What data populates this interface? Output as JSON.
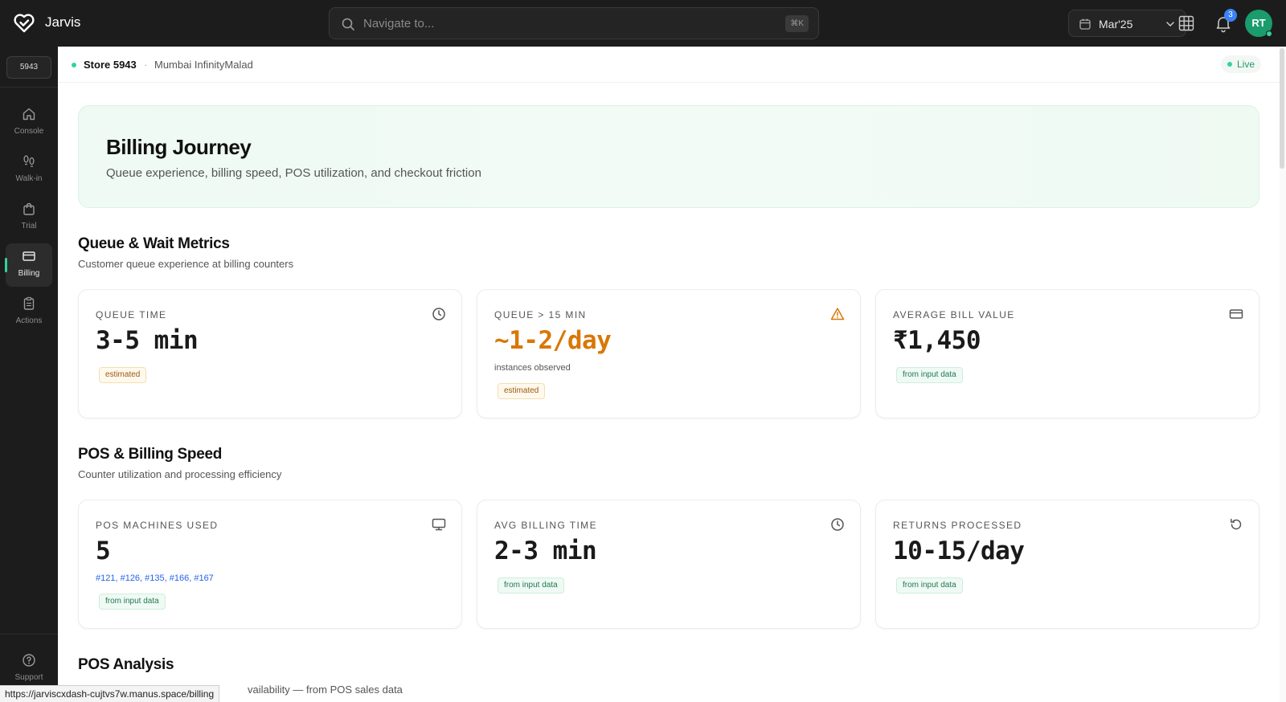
{
  "app": {
    "name": "Jarvis"
  },
  "search": {
    "placeholder": "Navigate to...",
    "shortcut": "⌘K"
  },
  "header": {
    "month": "Mar'25",
    "notifications_count": "3",
    "avatar_initials": "RT"
  },
  "sidebar": {
    "store_chip": "5943",
    "items": [
      {
        "label": "Console",
        "icon": "home-icon"
      },
      {
        "label": "Walk-in",
        "icon": "footprints-icon"
      },
      {
        "label": "Trial",
        "icon": "shopping-bag-icon"
      },
      {
        "label": "Billing",
        "icon": "credit-card-icon",
        "active": true
      },
      {
        "label": "Actions",
        "icon": "clipboard-icon"
      }
    ],
    "support": {
      "label": "Support",
      "icon": "help-circle-icon"
    }
  },
  "store": {
    "name": "Store 5943",
    "separator": "·",
    "location": "Mumbai InfinityMalad",
    "status": "Live"
  },
  "hero": {
    "title": "Billing Journey",
    "subtitle": "Queue experience, billing speed, POS utilization, and checkout friction"
  },
  "sections": [
    {
      "title": "Queue & Wait Metrics",
      "subtitle": "Customer queue experience at billing counters",
      "cards": [
        {
          "label": "QUEUE TIME",
          "value": "3-5 min",
          "icon": "clock-icon",
          "tag": "estimated"
        },
        {
          "label": "QUEUE > 15 MIN",
          "value": "~1-2/day",
          "note": "instances observed",
          "icon": "alert-triangle-icon",
          "tag": "estimated"
        },
        {
          "label": "AVERAGE BILL VALUE",
          "value": "₹1,450",
          "icon": "credit-card-icon",
          "tag": "from input data"
        }
      ]
    },
    {
      "title": "POS & Billing Speed",
      "subtitle": "Counter utilization and processing efficiency",
      "cards": [
        {
          "label": "POS MACHINES USED",
          "value": "5",
          "links": "#121, #126, #135, #166, #167",
          "icon": "monitor-icon",
          "tag": "from input data"
        },
        {
          "label": "AVG BILLING TIME",
          "value": "2-3 min",
          "icon": "clock-icon",
          "tag": "from input data"
        },
        {
          "label": "RETURNS PROCESSED",
          "value": "10-15/day",
          "icon": "refresh-icon",
          "tag": "from input data"
        }
      ]
    },
    {
      "title": "POS Analysis",
      "subtitle_visible_fragment": "vailability — from POS sales data"
    }
  ],
  "status_bar": {
    "url": "https://jarviscxdash-cujtvs7w.manus.space/billing"
  },
  "colors": {
    "accent": "#34d399",
    "topbar": "#1c1c1c",
    "warning": "#d97706",
    "link": "#2563eb",
    "badge": "#3b82f6"
  }
}
